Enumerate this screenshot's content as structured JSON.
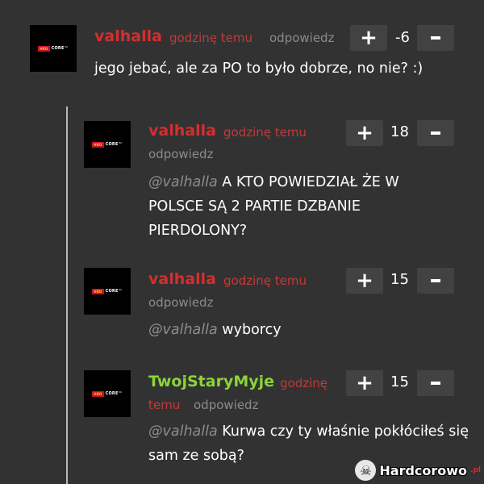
{
  "comments": [
    {
      "author": "valhalla",
      "time": "godzinę temu",
      "reply": "odpowiedz",
      "plus": "+",
      "score": "-6",
      "mention": "",
      "text": "jego jebać, ale za PO to było dobrze, no nie? :)"
    },
    {
      "author": "valhalla",
      "time": "godzinę temu",
      "reply": "odpowiedz",
      "plus": "+",
      "score": "18",
      "mention": "@valhalla",
      "text": "A KTO POWIEDZIAŁ ŻE W POLSCE SĄ 2 PARTIE DZBANIE PIERDOLONY?"
    },
    {
      "author": "valhalla",
      "time": "godzinę temu",
      "reply": "odpowiedz",
      "plus": "+",
      "score": "15",
      "mention": "@valhalla",
      "text": "wyborcy"
    },
    {
      "author": "TwojStaryMyje",
      "time_line1": "godzinę",
      "time_line2": "temu",
      "reply": "odpowiedz",
      "plus": "+",
      "score": "15",
      "mention": "@valhalla",
      "text": "Kurwa czy ty właśnie pokłóciłeś się sam ze sobą?"
    }
  ],
  "avatar_logo": {
    "red_part": "HRD",
    "white_part": "CORE™"
  },
  "watermark": {
    "text": "Hardcorowo",
    "suffix": ".pl"
  },
  "colors": {
    "background": "#323232",
    "author_red": "#d22f2f",
    "author_green": "#8bd43a",
    "button_bg": "#424242"
  }
}
